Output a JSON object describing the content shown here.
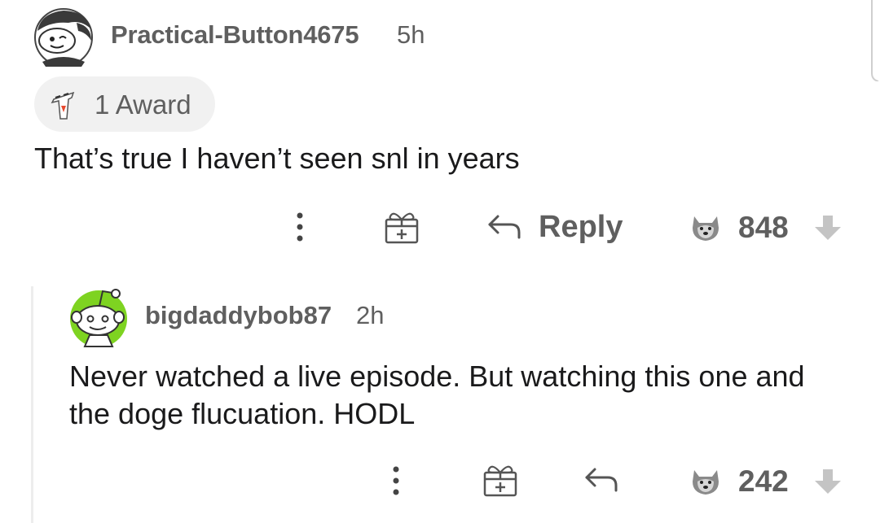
{
  "comments": [
    {
      "username": "Practical-Button4675",
      "time": "5h",
      "award": "1 Award",
      "body": "That’s true I haven’t seen snl in years",
      "actions": {
        "reply_label": "Reply",
        "score": "848"
      }
    },
    {
      "username": "bigdaddybob87",
      "time": "2h",
      "body": "Never watched a live episode. But watching this one and the doge flucuation. HODL",
      "actions": {
        "score": "242"
      }
    }
  ],
  "icons": {
    "more": "more-vertical-icon",
    "gift": "gift-icon",
    "reply": "reply-arrow-icon",
    "upvote": "doge-upvote-icon",
    "downvote": "downvote-arrow-icon",
    "award": "award-icon"
  },
  "colors": {
    "meta_text": "#5f5f5f",
    "body_text": "#1a1a1b",
    "award_pill": "#f1f1f1",
    "avatar2_accent": "#7ed321"
  }
}
